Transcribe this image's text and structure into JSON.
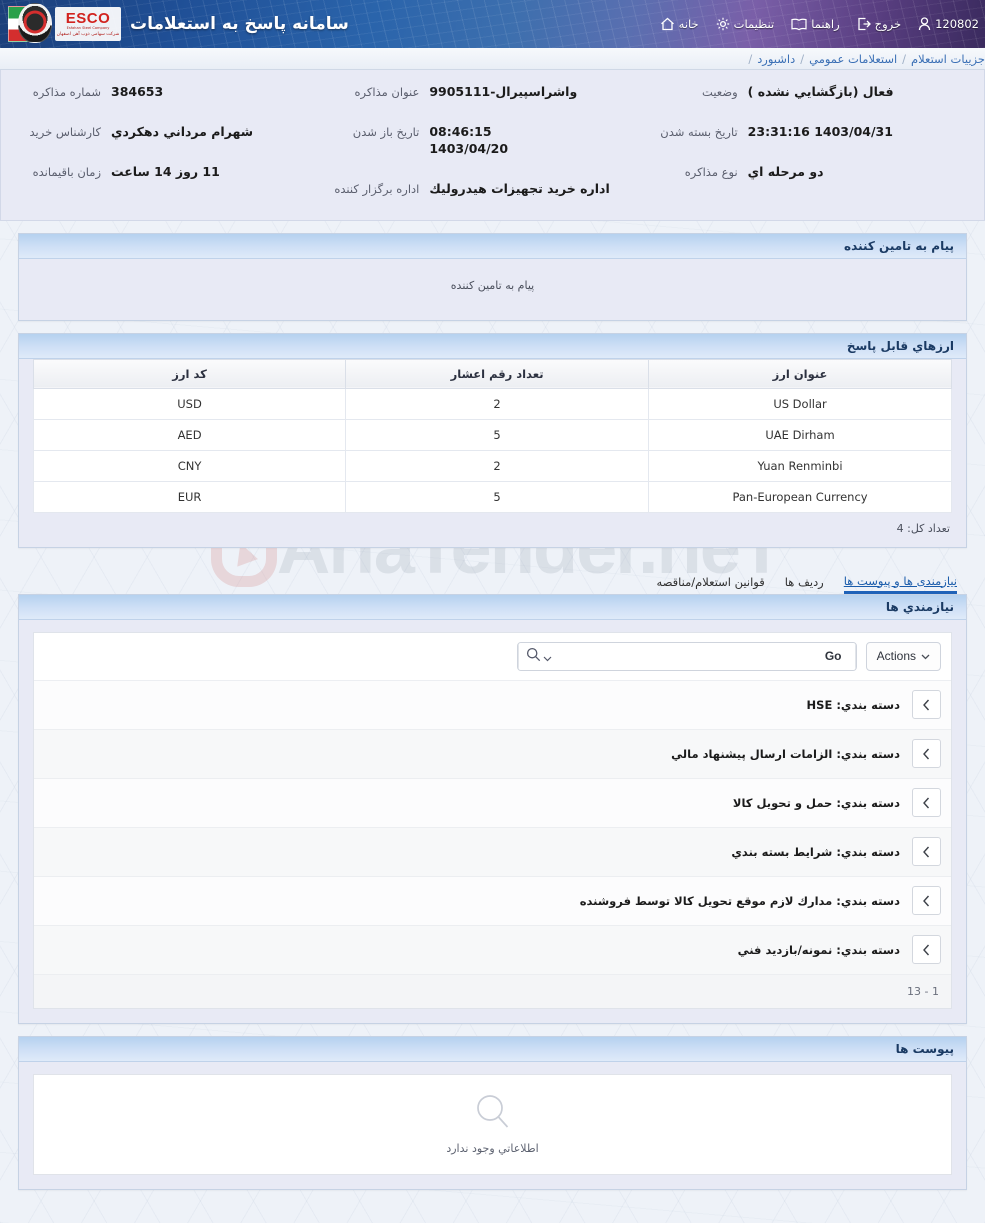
{
  "header": {
    "app_title": "سامانه پاسخ به استعلامات",
    "logo_word": "ESCO",
    "logo_sub_en": "Esfahan Steel Company",
    "logo_sub_fa": "شرکت سهامی ذوب آهن اصفهان",
    "nav": [
      {
        "label": "خانه",
        "icon": "home-icon"
      },
      {
        "label": "تنظیمات",
        "icon": "gear-icon"
      },
      {
        "label": "راهنما",
        "icon": "book-icon"
      },
      {
        "label": "خروج",
        "icon": "logout-icon"
      },
      {
        "label": "120802",
        "icon": "user-icon"
      }
    ]
  },
  "breadcrumb": {
    "items": [
      "داشبورد",
      "استعلامات عمومي",
      "جزییات استعلام"
    ],
    "separator": "/"
  },
  "summary": {
    "right": [
      {
        "label": "شماره مذاکره",
        "value": "384653"
      },
      {
        "label": "کارشناس خرید",
        "value": "شهرام مرداني دهکردي"
      },
      {
        "label": "زمان باقیمانده",
        "value": "11 روز 14 ساعت"
      }
    ],
    "middle": [
      {
        "label": "عنوان مذاکره",
        "value": "واشراسپیرال-9905111"
      },
      {
        "label": "تاریخ باز شدن",
        "value": "08:46:15\n1403/04/20"
      },
      {
        "label": "اداره برگزار کننده",
        "value": "اداره خرید تجهیزات هیدرولیك"
      }
    ],
    "left": [
      {
        "label": "وضعیت",
        "value": "فعال (بازگشایي نشده )"
      },
      {
        "label": "تاریخ بسته شدن",
        "value": "1403/04/31 23:31:16"
      },
      {
        "label": "نوع مذاکره",
        "value": "دو مرحله اي"
      }
    ]
  },
  "message_panel": {
    "title": "پیام به تامین کننده",
    "body": "پیام به تامین کننده"
  },
  "currency_panel": {
    "title": "ارزهاي قابل پاسخ",
    "columns": [
      "عنوان ارز",
      "تعداد رقم اعشار",
      "كد ارز"
    ],
    "rows": [
      {
        "name": "US Dollar",
        "decimals": "2",
        "code": "USD"
      },
      {
        "name": "UAE Dirham",
        "decimals": "5",
        "code": "AED"
      },
      {
        "name": "Yuan Renminbi",
        "decimals": "2",
        "code": "CNY"
      },
      {
        "name": "Pan-European Currency",
        "decimals": "5",
        "code": "EUR"
      }
    ],
    "total_label": "تعداد کل: 4"
  },
  "tabs": [
    {
      "label": "نیازمندی ها و پیوست ها",
      "active": true
    },
    {
      "label": "ردیف ها",
      "active": false
    },
    {
      "label": "قوانین استعلام/مناقصه",
      "active": false
    }
  ],
  "requirements_panel": {
    "title": "نیازمندي ها",
    "search_placeholder": "",
    "search_value": "",
    "go_label": "Go",
    "actions_label": "Actions",
    "rows": [
      {
        "label": "دسته بندي: HSE"
      },
      {
        "label": "دسته بندي: الزامات ارسال پیشنهاد مالي"
      },
      {
        "label": "دسته بندي: حمل و تحویل کالا"
      },
      {
        "label": "دسته بندي: شرایط بسته بندي"
      },
      {
        "label": "دسته بندي: مدارك لازم موقع تحویل کالا توسط فروشنده"
      },
      {
        "label": "دسته بندي: نمونه/بازدید فني"
      }
    ],
    "pager": "13 - 1"
  },
  "attachments_panel": {
    "title": "پیوست ها",
    "empty_text": "اطلاعاتي وجود ندارد"
  },
  "watermark": "AriaTender.neT",
  "colors": {
    "accent": "#1f62b8",
    "panel_header_from": "#b5d1ef",
    "panel_header_to": "#dfeaf9",
    "panel_body": "#e8eaf5",
    "link": "#3a6fb5",
    "logo_red": "#d2231f"
  }
}
